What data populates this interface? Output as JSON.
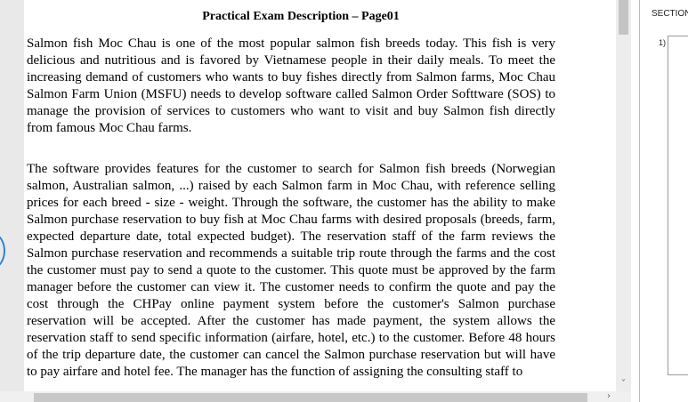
{
  "document": {
    "title": "Practical Exam Description – Page01",
    "paragraphs": [
      "Salmon fish Moc Chau is one of the most popular salmon fish breeds today. This fish is very delicious and nutritious and is favored by Vietnamese people in their daily meals. To meet the increasing demand of customers who wants to buy fishes directly from Salmon farms, Moc Chau Salmon Farm Union (MSFU) needs to develop software called Salmon Order Softtware (SOS) to manage the provision of services to customers who want to visit and buy Salmon fish directly from famous Moc Chau farms.",
      "The software provides features for the customer to search for Salmon fish breeds (Norwegian salmon, Australian salmon, ...) raised by each Salmon farm in Moc Chau, with reference selling prices for each breed - size - weight. Through the software, the customer has the ability to make Salmon purchase reservation to buy fish at Moc Chau farms with desired proposals (breeds, farm, expected departure date, total expected budget). The reservation staff of the farm reviews the Salmon purchase reservation and recommends a suitable trip route through the farms and the cost the customer must pay to send a quote to the customer. This quote must be approved by the farm manager before the customer can view it. The customer needs to confirm the quote and pay the cost through the CHPay online payment system before the customer's Salmon purchase reservation will be accepted. After the customer has made payment, the system allows the reservation staff to send specific information (airfare, hotel, etc.) to the customer. Before 48 hours of the trip departure date, the customer can cancel the Salmon purchase reservation but will have to pay airfare and hotel fee. The manager has the function of assigning the consulting staff to"
    ]
  },
  "scrollbars": {
    "vertical_down_glyph": "˅",
    "horizontal_right_glyph": "›"
  },
  "answer_panel": {
    "section_label": "SECTION",
    "question_number": "1)"
  },
  "colors": {
    "accent_circle": "#2a84d6",
    "scrollbar_track": "#ededed",
    "scrollbar_thumb": "#c4c4c4"
  }
}
